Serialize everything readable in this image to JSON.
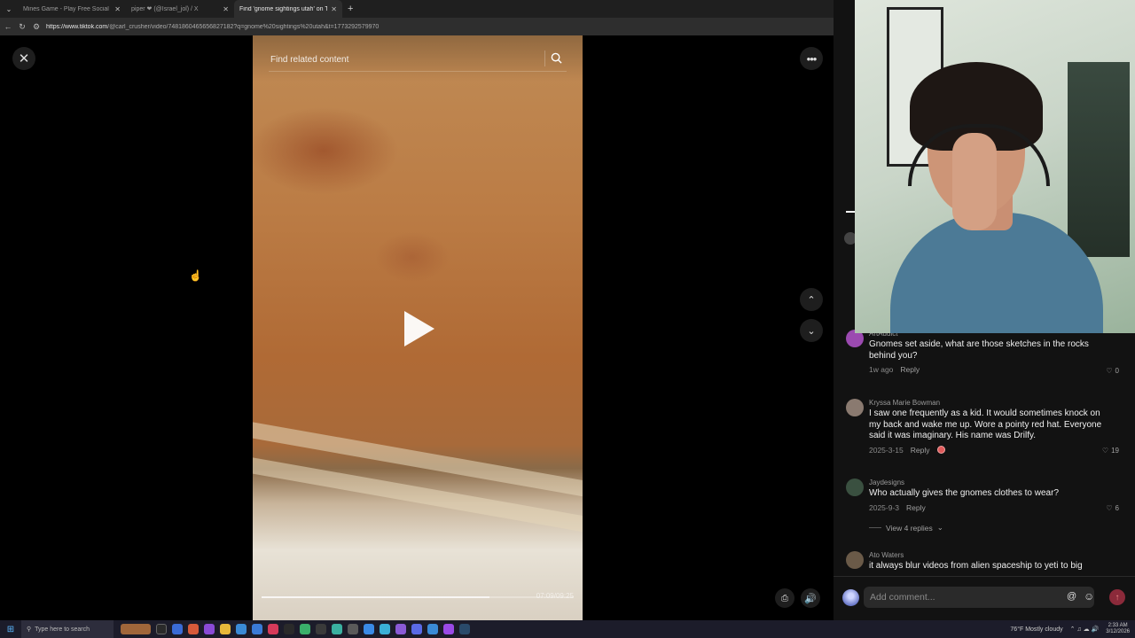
{
  "browser": {
    "tabs": [
      {
        "title": "Mines Game - Play Free Social Ca",
        "active": false
      },
      {
        "title": "piper ❤ (@Israel_jol) / X",
        "active": false
      },
      {
        "title": "Find 'gnome sightings utah' on T",
        "active": true
      }
    ],
    "url_host": "https://www.tiktok.com",
    "url_path": "/@carl_crusher/video/7481860465656827182?q=gnome%20sightings%20utah&t=1773292579970"
  },
  "video": {
    "search_placeholder": "Find related content",
    "progress_fraction": 0.73,
    "time_display": "07:09/09:25"
  },
  "comments": [
    {
      "user": "ArtAddict",
      "text": "Gnomes set aside, what are those sketches in the rocks behind you?",
      "date": "1w ago",
      "reply": "Reply",
      "likes": "0",
      "avatar_color": "#9b4ab0"
    },
    {
      "user": "Kryssa Marie Bowman",
      "text": "I saw one frequently as a kid. It would sometimes knock on my back and wake me up. Wore a pointy red hat. Everyone said it was imaginary. His name was Drilfy.",
      "date": "2025-3-15",
      "reply": "Reply",
      "likes": "19",
      "avatar_color": "#8a7a70"
    },
    {
      "user": "Jaydesigns",
      "text": "Who actually gives the gnomes clothes to wear?",
      "date": "2025-9-3",
      "reply": "Reply",
      "likes": "6",
      "avatar_color": "#3a5040"
    },
    {
      "user": "Ato Waters",
      "text": "it always blur videos from alien spaceship to yeti to big",
      "date": "",
      "reply": "",
      "likes": "",
      "avatar_color": "#6a5a48"
    }
  ],
  "view_replies_label": "View 4 replies",
  "comment_bar": {
    "placeholder": "Add comment..."
  },
  "taskbar": {
    "search_placeholder": "Type here to search",
    "weather": "76°F  Mostly cloudy",
    "time": "2:33 AM",
    "date": "3/12/2026"
  }
}
